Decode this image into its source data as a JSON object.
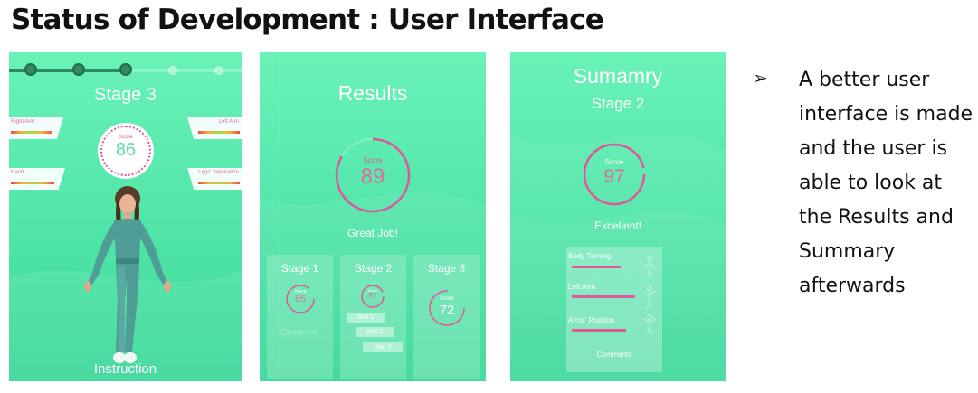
{
  "slide": {
    "title": "Status of Development : User Interface",
    "bullet_marker": "➢",
    "bullet_text": "A better user interface is made and the user is able to look at the Results and Summary afterwards"
  },
  "stage_screen": {
    "stage_title": "Stage 3",
    "progress": {
      "current_step": 3,
      "total_steps": 5
    },
    "meters": {
      "right_arm": "Right Arm",
      "left_arm": "Left Arm",
      "hand": "Hand",
      "legs_separation": "Legs' Separation"
    },
    "score_label": "Score",
    "score_value": "86",
    "instruction": "Instruction"
  },
  "results_screen": {
    "title": "Results",
    "score_label": "Score",
    "score_value": "89",
    "verdict": "Great Job!",
    "stages": [
      {
        "title": "Stage 1",
        "score_label": "Score",
        "score_value": "85",
        "comment": "Comment"
      },
      {
        "title": "Stage 2",
        "score_label": "Score",
        "score_value": "97",
        "stats": [
          "Stat 1",
          "Stat 2",
          "Stat 3"
        ]
      },
      {
        "title": "Stage 3",
        "score_label": "Score",
        "score_value": "72"
      }
    ]
  },
  "summary_screen": {
    "title": "Sumamry",
    "stage": "Stage 2",
    "score_label": "Score",
    "score_value": "97",
    "verdict": "Excellent!",
    "rows": [
      {
        "label": "Body Turning"
      },
      {
        "label": "Left Arm"
      },
      {
        "label": "Arms' Position"
      }
    ],
    "comments": "Comments"
  },
  "colors": {
    "panel_green": "#55e7ab",
    "score_pink": "#e0559a",
    "dark_green": "#2f8a63"
  }
}
